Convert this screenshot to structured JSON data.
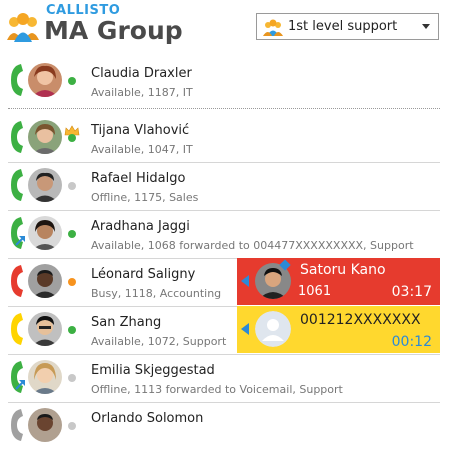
{
  "header": {
    "brand": "CALLISTO",
    "title": "MA Group",
    "group_select": {
      "value": "1st level support"
    }
  },
  "contacts": [
    {
      "name": "Claudia Draxler",
      "detail": "Available, 1187, IT",
      "status": "available",
      "phone": "green"
    },
    {
      "name": "Tijana Vlahović",
      "detail": "Available, 1047, IT",
      "status": "available",
      "phone": "green",
      "crown": true
    },
    {
      "name": "Rafael Hidalgo",
      "detail": "Offline, 1175, Sales",
      "status": "offline",
      "phone": "green"
    },
    {
      "name": "Aradhana Jaggi",
      "detail": "Available, 1068 forwarded to 004477XXXXXXXXX, Support",
      "status": "available",
      "phone": "green",
      "forward": true
    },
    {
      "name": "Léonard Saligny",
      "detail": "Busy, 1118, Accounting",
      "status": "busy",
      "phone": "red"
    },
    {
      "name": "San Zhang",
      "detail": "Available, 1072, Support",
      "status": "available",
      "phone": "yellow"
    },
    {
      "name": "Emilia Skjeggestad",
      "detail": "Offline, 1113 forwarded to Voicemail, Support",
      "status": "offline",
      "phone": "green",
      "forward": true
    },
    {
      "name": "Orlando Solomon",
      "detail": "",
      "status": "offline",
      "phone": "gray"
    }
  ],
  "active_calls": [
    {
      "name": "Satoru Kano",
      "number": "1061",
      "duration": "03:17",
      "state": "connected"
    },
    {
      "name": "001212XXXXXXX",
      "number": "",
      "duration": "00:12",
      "state": "ringing"
    }
  ],
  "colors": {
    "available": "#3cb043",
    "offline": "#c8c8c8",
    "busy": "#f7931e",
    "phone_green": "#3cb043",
    "phone_red": "#e63b2e",
    "phone_yellow": "#ffd400",
    "phone_gray": "#a0a0a0",
    "accent": "#2b8ad6",
    "call_red": "#e63b2e",
    "call_yellow": "#ffd82e"
  }
}
